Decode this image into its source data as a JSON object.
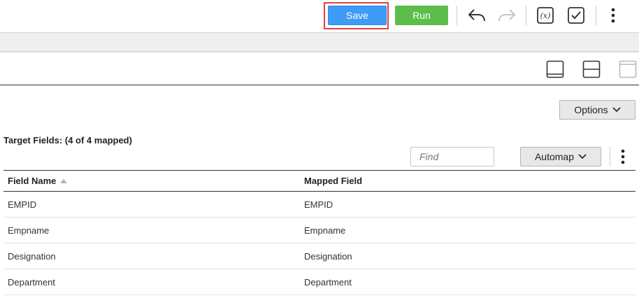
{
  "toolbar": {
    "save_label": "Save",
    "run_label": "Run",
    "icons": [
      "undo-icon",
      "redo-icon",
      "function-icon",
      "validate-icon",
      "more-icon"
    ]
  },
  "layout_icons": [
    "layout-bottom-panel-icon",
    "layout-split-icon",
    "layout-top-panel-icon"
  ],
  "options": {
    "label": "Options"
  },
  "target": {
    "title": "Target Fields: (4 of 4 mapped)",
    "find_placeholder": "Find",
    "automap_label": "Automap"
  },
  "grid": {
    "columns": [
      "Field Name",
      "Mapped Field"
    ],
    "sort_indicator": "ascending",
    "rows": [
      [
        "EMPID",
        "EMPID"
      ],
      [
        "Empname",
        "Empname"
      ],
      [
        "Designation",
        "Designation"
      ],
      [
        "Department",
        "Department"
      ]
    ]
  },
  "colors": {
    "save": "#3d9cf5",
    "run": "#5cbd4b",
    "highlight": "#e0413a"
  }
}
